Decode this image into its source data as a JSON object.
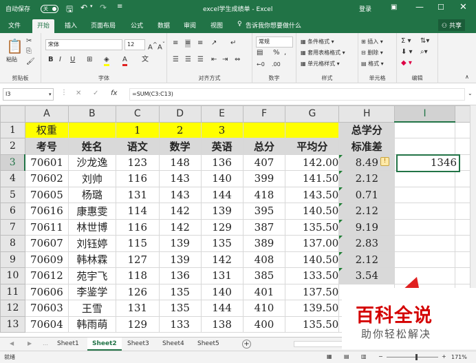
{
  "titlebar": {
    "autosave_label": "自动保存",
    "autosave_state": "关",
    "title": "excel学生成绩单 - Excel",
    "login": "登录"
  },
  "ribbon_tabs": [
    "文件",
    "开始",
    "插入",
    "页面布局",
    "公式",
    "数据",
    "审阅",
    "视图"
  ],
  "active_tab": "开始",
  "tell_me": "告诉我你想要做什么",
  "share": "共享",
  "ribbon": {
    "clipboard": {
      "label": "剪贴板",
      "paste": "粘贴"
    },
    "font": {
      "label": "字体",
      "name": "宋体",
      "size": "12",
      "bold": "B",
      "italic": "I",
      "underline": "U"
    },
    "alignment": {
      "label": "对齐方式"
    },
    "number": {
      "label": "数字",
      "format": "常规"
    },
    "styles": {
      "label": "样式",
      "cond": "条件格式",
      "table": "套用表格格式",
      "cell": "单元格样式"
    },
    "cells": {
      "label": "单元格",
      "insert": "插入",
      "delete": "删除",
      "format": "格式"
    },
    "editing": {
      "label": "编辑"
    }
  },
  "formula_bar": {
    "name_box": "I3",
    "fx": "fx",
    "formula": "=SUM(C3:C13)"
  },
  "columns": [
    "A",
    "B",
    "C",
    "D",
    "E",
    "F",
    "G",
    "H",
    "I"
  ],
  "selected_column": "I",
  "selected_row": "3",
  "rows": [
    {
      "n": "1",
      "cells": [
        "权重",
        "",
        "1",
        "2",
        "3",
        "",
        "",
        "总学分",
        ""
      ]
    },
    {
      "n": "2",
      "cells": [
        "考号",
        "姓名",
        "语文",
        "数学",
        "英语",
        "总分",
        "平均分",
        "标准差",
        ""
      ]
    },
    {
      "n": "3",
      "cells": [
        "70601",
        "沙龙逸",
        "123",
        "148",
        "136",
        "407",
        "142.00",
        "8.49",
        "1346"
      ]
    },
    {
      "n": "4",
      "cells": [
        "70602",
        "刘帅",
        "116",
        "143",
        "140",
        "399",
        "141.50",
        "2.12",
        ""
      ]
    },
    {
      "n": "5",
      "cells": [
        "70605",
        "杨璐",
        "131",
        "143",
        "144",
        "418",
        "143.50",
        "0.71",
        ""
      ]
    },
    {
      "n": "6",
      "cells": [
        "70616",
        "康惠雯",
        "114",
        "142",
        "139",
        "395",
        "140.50",
        "2.12",
        ""
      ]
    },
    {
      "n": "7",
      "cells": [
        "70611",
        "林世博",
        "116",
        "142",
        "129",
        "387",
        "135.50",
        "9.19",
        ""
      ]
    },
    {
      "n": "8",
      "cells": [
        "70607",
        "刘钰婷",
        "115",
        "139",
        "135",
        "389",
        "137.00",
        "2.83",
        ""
      ]
    },
    {
      "n": "9",
      "cells": [
        "70609",
        "韩林霖",
        "127",
        "139",
        "142",
        "408",
        "140.50",
        "2.12",
        ""
      ]
    },
    {
      "n": "10",
      "cells": [
        "70612",
        "苑宇飞",
        "118",
        "136",
        "131",
        "385",
        "133.50",
        "3.54",
        ""
      ]
    },
    {
      "n": "11",
      "cells": [
        "70606",
        "李鉴学",
        "126",
        "135",
        "140",
        "401",
        "137.50",
        "",
        ""
      ]
    },
    {
      "n": "12",
      "cells": [
        "70603",
        "王雪",
        "131",
        "135",
        "144",
        "410",
        "139.50",
        "",
        ""
      ]
    },
    {
      "n": "13",
      "cells": [
        "70604",
        "韩雨萌",
        "129",
        "133",
        "138",
        "400",
        "135.50",
        "",
        ""
      ]
    }
  ],
  "sheets": [
    "Sheet1",
    "Sheet2",
    "Sheet3",
    "Sheet4",
    "Sheet5"
  ],
  "active_sheet": "Sheet2",
  "status": {
    "ready": "就绪",
    "zoom": "171%"
  },
  "watermark": {
    "title": "百科全说",
    "subtitle": "助你轻松解决"
  },
  "colors": {
    "excel_green": "#217346",
    "highlight": "#ffff00",
    "gray_fill": "#d9d9d9",
    "arrow": "#e02020",
    "watermark_red": "#d40000"
  }
}
